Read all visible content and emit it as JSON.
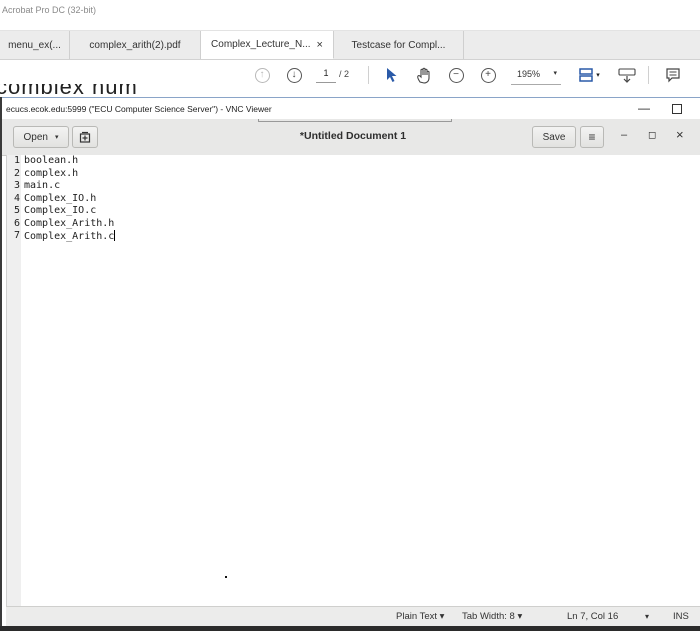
{
  "acrobat": {
    "title": "Acrobat Pro DC (32-bit)",
    "tabs": [
      {
        "label": "menu_ex(...",
        "active": false
      },
      {
        "label": "complex_arith(2).pdf",
        "active": false
      },
      {
        "label": "Complex_Lecture_N...",
        "active": true,
        "close": "×"
      },
      {
        "label": "Testcase for Compl...",
        "active": false
      }
    ],
    "toolbar": {
      "page_current": "1",
      "page_total": "/ 2",
      "zoom": "195%",
      "zoom_arrow": "▾",
      "up_glyph": "↑",
      "down_glyph": "↓",
      "zoom_out_glyph": "−",
      "zoom_in_glyph": "+",
      "pointer_glyph": "➤",
      "hand_glyph": "✋",
      "tool_arrow": "▾"
    },
    "behind_text": "complex num"
  },
  "vnc": {
    "title": "ecucs.ecok.edu:5999 (\"ECU Computer Science Server\") - VNC Viewer",
    "minimize": "—"
  },
  "gedit": {
    "open_label": "Open",
    "open_arrow": "▾",
    "document_title": "*Untitled Document 1",
    "save_label": "Save",
    "menu_glyph": "≡",
    "minimize_glyph": "–",
    "maximize_glyph": "◻",
    "close_glyph": "×",
    "lines": [
      {
        "n": "1",
        "text": "boolean.h"
      },
      {
        "n": "2",
        "text": "complex.h"
      },
      {
        "n": "3",
        "text": "main.c"
      },
      {
        "n": "4",
        "text": "Complex_IO.h"
      },
      {
        "n": "5",
        "text": "Complex_IO.c"
      },
      {
        "n": "6",
        "text": "Complex_Arith.h"
      },
      {
        "n": "7",
        "text": "Complex_Arith.c"
      }
    ],
    "status": {
      "language": "Plain Text ▾",
      "tab_width": "Tab Width: 8 ▾",
      "position": "Ln 7, Col 16",
      "pos_arrow": "▾",
      "mode": "INS"
    }
  }
}
